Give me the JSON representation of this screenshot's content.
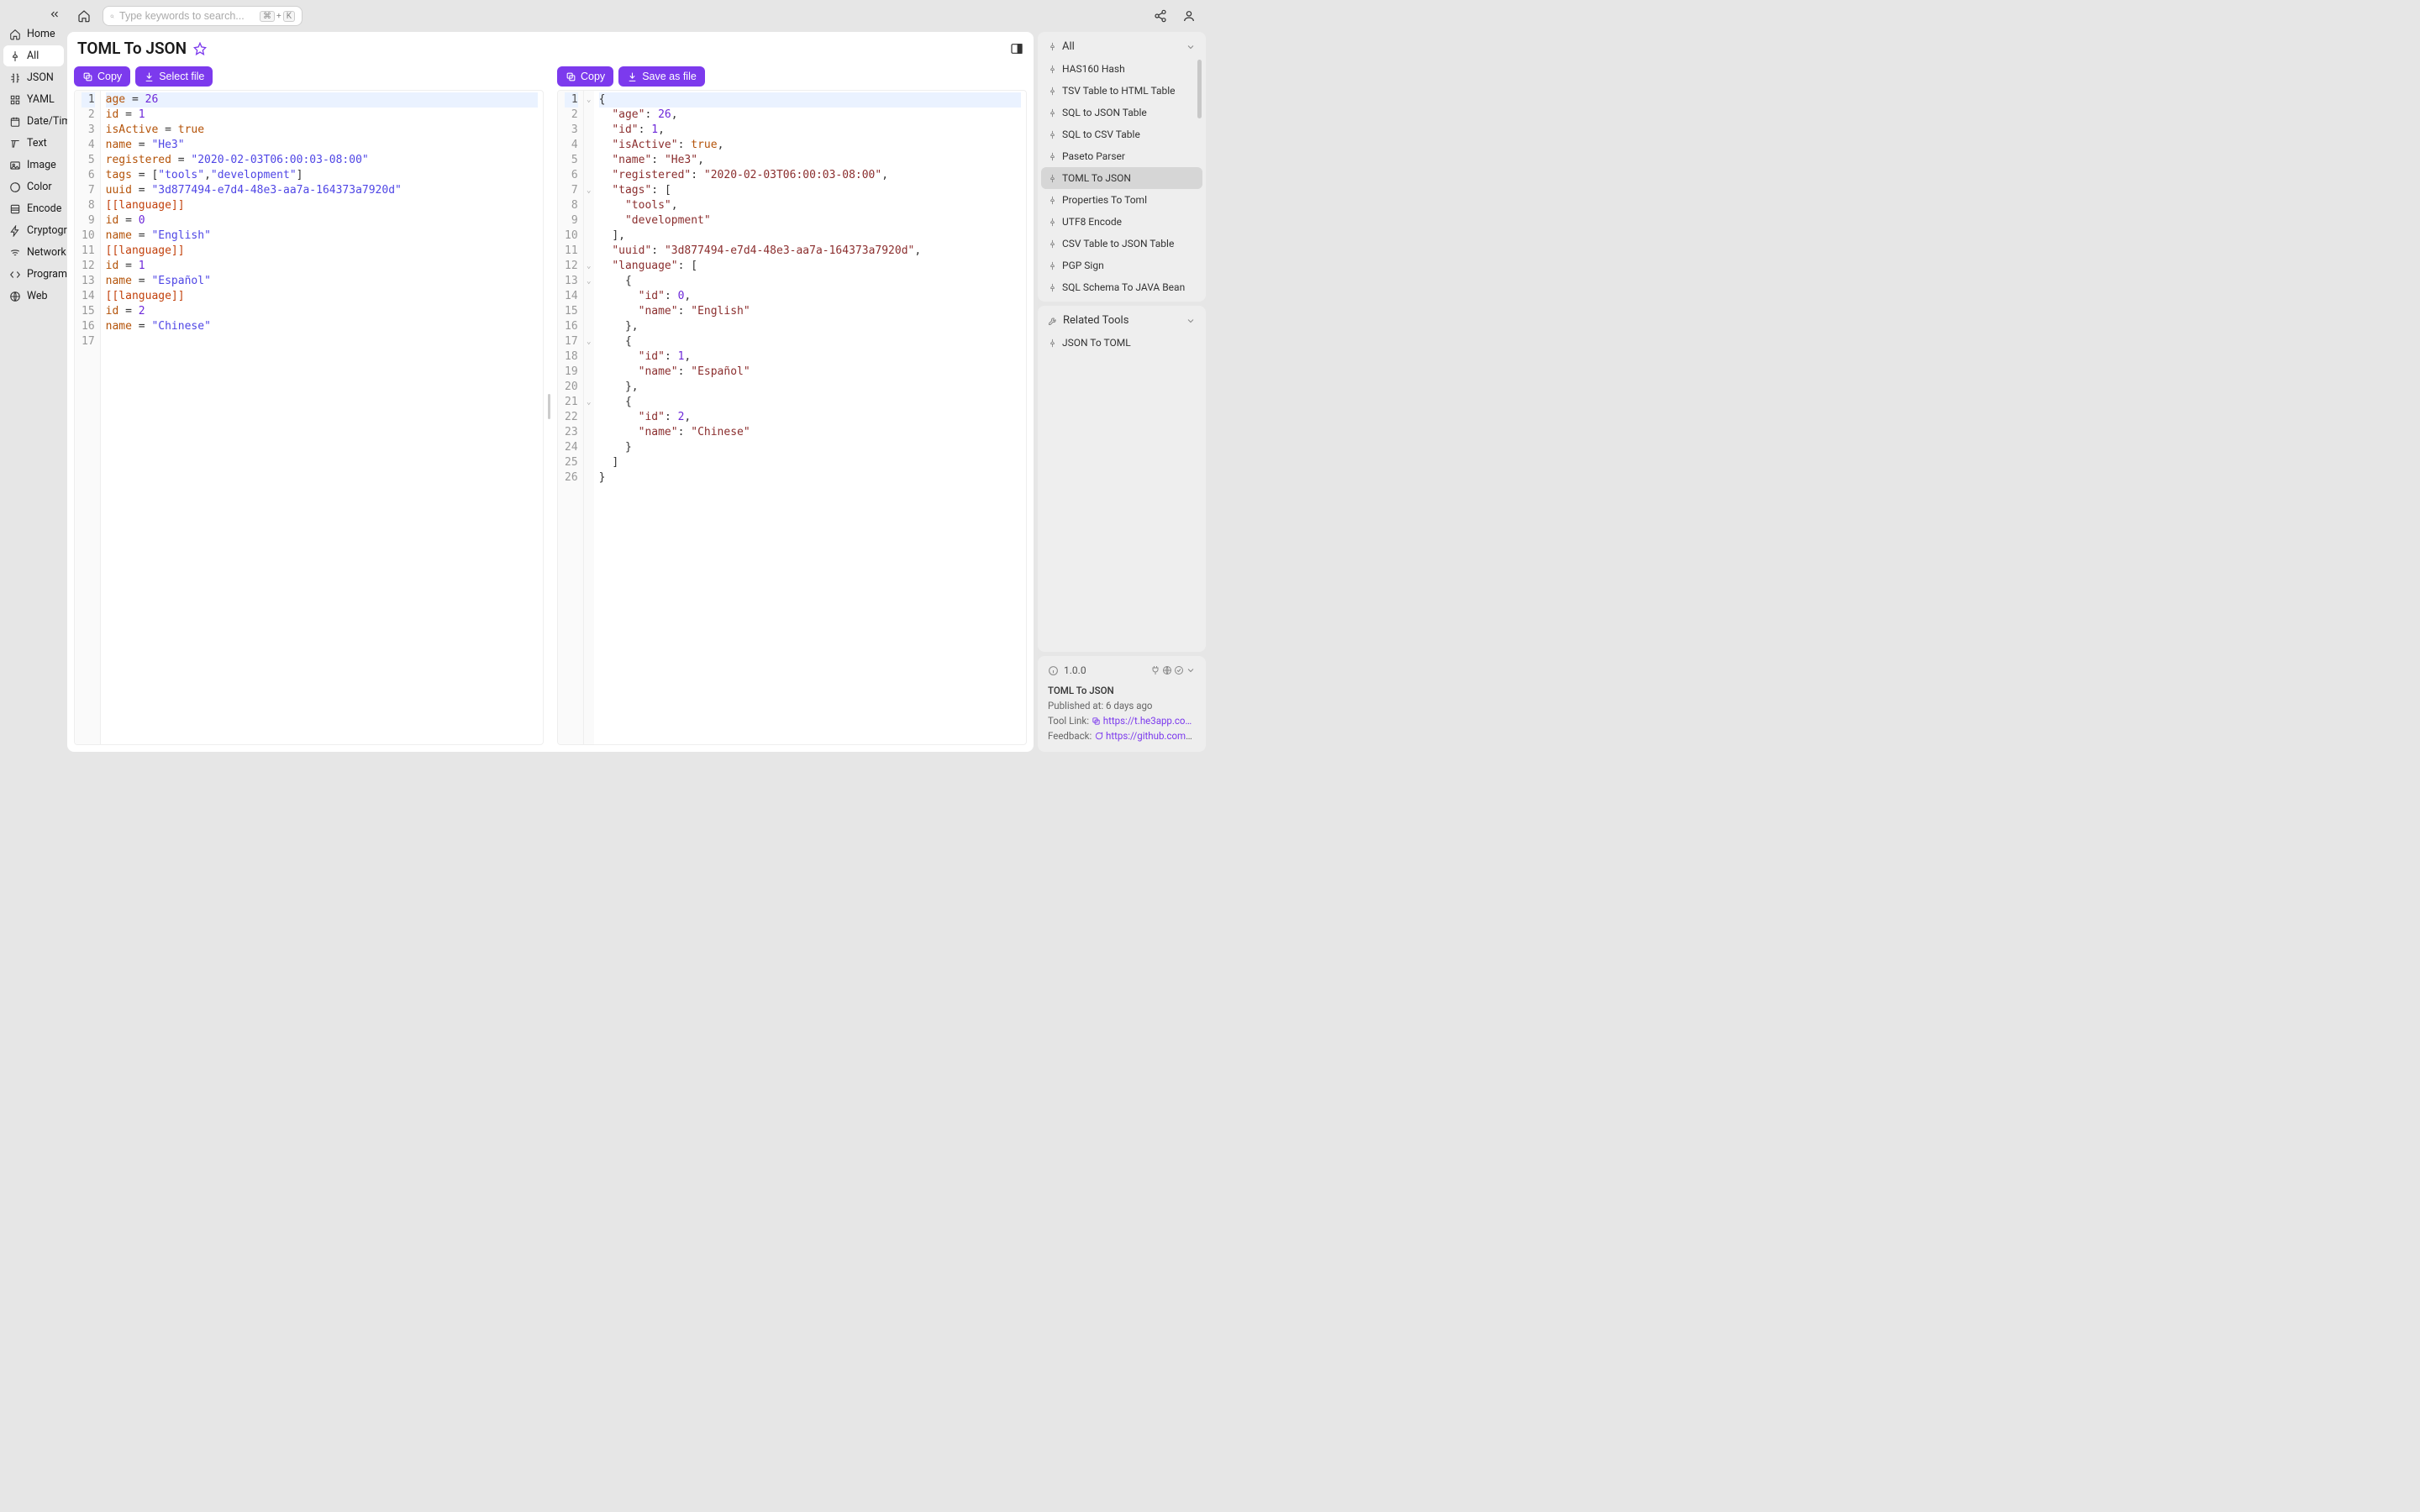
{
  "search": {
    "placeholder": "Type keywords to search...",
    "kbd1": "⌘",
    "plus": "+",
    "kbd2": "K"
  },
  "sidebar": {
    "items": [
      {
        "label": "Home"
      },
      {
        "label": "All"
      },
      {
        "label": "JSON"
      },
      {
        "label": "YAML"
      },
      {
        "label": "Date/Time"
      },
      {
        "label": "Text"
      },
      {
        "label": "Image"
      },
      {
        "label": "Color"
      },
      {
        "label": "Encode"
      },
      {
        "label": "Cryptography"
      },
      {
        "label": "Network"
      },
      {
        "label": "Programming"
      },
      {
        "label": "Web"
      }
    ]
  },
  "page": {
    "title": "TOML To JSON"
  },
  "buttons": {
    "copy": "Copy",
    "select_file": "Select file",
    "save_as_file": "Save as file"
  },
  "editor_left": {
    "lines": [
      [
        {
          "t": "age ",
          "c": "tok-key"
        },
        {
          "t": "= ",
          "c": "tok-op"
        },
        {
          "t": "26",
          "c": "tok-num"
        }
      ],
      [
        {
          "t": "id ",
          "c": "tok-key"
        },
        {
          "t": "= ",
          "c": "tok-op"
        },
        {
          "t": "1",
          "c": "tok-num"
        }
      ],
      [
        {
          "t": "isActive ",
          "c": "tok-key"
        },
        {
          "t": "= ",
          "c": "tok-op"
        },
        {
          "t": "true",
          "c": "tok-bool"
        }
      ],
      [
        {
          "t": "name ",
          "c": "tok-key"
        },
        {
          "t": "= ",
          "c": "tok-op"
        },
        {
          "t": "\"He3\"",
          "c": "tok-str"
        }
      ],
      [
        {
          "t": "registered ",
          "c": "tok-key"
        },
        {
          "t": "= ",
          "c": "tok-op"
        },
        {
          "t": "\"2020-02-03T06:00:03-08:00\"",
          "c": "tok-str"
        }
      ],
      [
        {
          "t": "tags ",
          "c": "tok-key"
        },
        {
          "t": "= ",
          "c": "tok-op"
        },
        {
          "t": "[",
          "c": "tok-punct"
        },
        {
          "t": "\"tools\"",
          "c": "tok-str"
        },
        {
          "t": ",",
          "c": "tok-punct"
        },
        {
          "t": "\"development\"",
          "c": "tok-str"
        },
        {
          "t": "]",
          "c": "tok-punct"
        }
      ],
      [
        {
          "t": "uuid ",
          "c": "tok-key"
        },
        {
          "t": "= ",
          "c": "tok-op"
        },
        {
          "t": "\"3d877494-e7d4-48e3-aa7a-164373a7920d\"",
          "c": "tok-str"
        }
      ],
      [
        {
          "t": "[[language]]",
          "c": "tok-sect"
        }
      ],
      [
        {
          "t": "id ",
          "c": "tok-key"
        },
        {
          "t": "= ",
          "c": "tok-op"
        },
        {
          "t": "0",
          "c": "tok-num"
        }
      ],
      [
        {
          "t": "name ",
          "c": "tok-key"
        },
        {
          "t": "= ",
          "c": "tok-op"
        },
        {
          "t": "\"English\"",
          "c": "tok-str"
        }
      ],
      [
        {
          "t": "[[language]]",
          "c": "tok-sect"
        }
      ],
      [
        {
          "t": "id ",
          "c": "tok-key"
        },
        {
          "t": "= ",
          "c": "tok-op"
        },
        {
          "t": "1",
          "c": "tok-num"
        }
      ],
      [
        {
          "t": "name ",
          "c": "tok-key"
        },
        {
          "t": "= ",
          "c": "tok-op"
        },
        {
          "t": "\"Español\"",
          "c": "tok-str"
        }
      ],
      [
        {
          "t": "[[language]]",
          "c": "tok-sect"
        }
      ],
      [
        {
          "t": "id ",
          "c": "tok-key"
        },
        {
          "t": "= ",
          "c": "tok-op"
        },
        {
          "t": "2",
          "c": "tok-num"
        }
      ],
      [
        {
          "t": "name ",
          "c": "tok-key"
        },
        {
          "t": "= ",
          "c": "tok-op"
        },
        {
          "t": "\"Chinese\"",
          "c": "tok-str"
        }
      ],
      [
        {
          "t": "",
          "c": ""
        }
      ]
    ],
    "line_count": 17
  },
  "editor_right": {
    "lines": [
      [
        {
          "t": "{",
          "c": "tok-punct"
        }
      ],
      [
        {
          "t": "  ",
          "c": ""
        },
        {
          "t": "\"age\"",
          "c": "tok-jkey"
        },
        {
          "t": ": ",
          "c": "tok-punct"
        },
        {
          "t": "26",
          "c": "tok-num"
        },
        {
          "t": ",",
          "c": "tok-punct"
        }
      ],
      [
        {
          "t": "  ",
          "c": ""
        },
        {
          "t": "\"id\"",
          "c": "tok-jkey"
        },
        {
          "t": ": ",
          "c": "tok-punct"
        },
        {
          "t": "1",
          "c": "tok-num"
        },
        {
          "t": ",",
          "c": "tok-punct"
        }
      ],
      [
        {
          "t": "  ",
          "c": ""
        },
        {
          "t": "\"isActive\"",
          "c": "tok-jkey"
        },
        {
          "t": ": ",
          "c": "tok-punct"
        },
        {
          "t": "true",
          "c": "tok-bool"
        },
        {
          "t": ",",
          "c": "tok-punct"
        }
      ],
      [
        {
          "t": "  ",
          "c": ""
        },
        {
          "t": "\"name\"",
          "c": "tok-jkey"
        },
        {
          "t": ": ",
          "c": "tok-punct"
        },
        {
          "t": "\"He3\"",
          "c": "tok-str2"
        },
        {
          "t": ",",
          "c": "tok-punct"
        }
      ],
      [
        {
          "t": "  ",
          "c": ""
        },
        {
          "t": "\"registered\"",
          "c": "tok-jkey"
        },
        {
          "t": ": ",
          "c": "tok-punct"
        },
        {
          "t": "\"2020-02-03T06:00:03-08:00\"",
          "c": "tok-str2"
        },
        {
          "t": ",",
          "c": "tok-punct"
        }
      ],
      [
        {
          "t": "  ",
          "c": ""
        },
        {
          "t": "\"tags\"",
          "c": "tok-jkey"
        },
        {
          "t": ": ",
          "c": "tok-punct"
        },
        {
          "t": "[",
          "c": "tok-punct"
        }
      ],
      [
        {
          "t": "    ",
          "c": ""
        },
        {
          "t": "\"tools\"",
          "c": "tok-str2"
        },
        {
          "t": ",",
          "c": "tok-punct"
        }
      ],
      [
        {
          "t": "    ",
          "c": ""
        },
        {
          "t": "\"development\"",
          "c": "tok-str2"
        }
      ],
      [
        {
          "t": "  ",
          "c": ""
        },
        {
          "t": "]",
          "c": "tok-punct"
        },
        {
          "t": ",",
          "c": "tok-punct"
        }
      ],
      [
        {
          "t": "  ",
          "c": ""
        },
        {
          "t": "\"uuid\"",
          "c": "tok-jkey"
        },
        {
          "t": ": ",
          "c": "tok-punct"
        },
        {
          "t": "\"3d877494-e7d4-48e3-aa7a-164373a7920d\"",
          "c": "tok-str2"
        },
        {
          "t": ",",
          "c": "tok-punct"
        }
      ],
      [
        {
          "t": "  ",
          "c": ""
        },
        {
          "t": "\"language\"",
          "c": "tok-jkey"
        },
        {
          "t": ": ",
          "c": "tok-punct"
        },
        {
          "t": "[",
          "c": "tok-punct"
        }
      ],
      [
        {
          "t": "    ",
          "c": ""
        },
        {
          "t": "{",
          "c": "tok-punct"
        }
      ],
      [
        {
          "t": "      ",
          "c": ""
        },
        {
          "t": "\"id\"",
          "c": "tok-jkey"
        },
        {
          "t": ": ",
          "c": "tok-punct"
        },
        {
          "t": "0",
          "c": "tok-num"
        },
        {
          "t": ",",
          "c": "tok-punct"
        }
      ],
      [
        {
          "t": "      ",
          "c": ""
        },
        {
          "t": "\"name\"",
          "c": "tok-jkey"
        },
        {
          "t": ": ",
          "c": "tok-punct"
        },
        {
          "t": "\"English\"",
          "c": "tok-str2"
        }
      ],
      [
        {
          "t": "    ",
          "c": ""
        },
        {
          "t": "}",
          "c": "tok-punct"
        },
        {
          "t": ",",
          "c": "tok-punct"
        }
      ],
      [
        {
          "t": "    ",
          "c": ""
        },
        {
          "t": "{",
          "c": "tok-punct"
        }
      ],
      [
        {
          "t": "      ",
          "c": ""
        },
        {
          "t": "\"id\"",
          "c": "tok-jkey"
        },
        {
          "t": ": ",
          "c": "tok-punct"
        },
        {
          "t": "1",
          "c": "tok-num"
        },
        {
          "t": ",",
          "c": "tok-punct"
        }
      ],
      [
        {
          "t": "      ",
          "c": ""
        },
        {
          "t": "\"name\"",
          "c": "tok-jkey"
        },
        {
          "t": ": ",
          "c": "tok-punct"
        },
        {
          "t": "\"Español\"",
          "c": "tok-str2"
        }
      ],
      [
        {
          "t": "    ",
          "c": ""
        },
        {
          "t": "}",
          "c": "tok-punct"
        },
        {
          "t": ",",
          "c": "tok-punct"
        }
      ],
      [
        {
          "t": "    ",
          "c": ""
        },
        {
          "t": "{",
          "c": "tok-punct"
        }
      ],
      [
        {
          "t": "      ",
          "c": ""
        },
        {
          "t": "\"id\"",
          "c": "tok-jkey"
        },
        {
          "t": ": ",
          "c": "tok-punct"
        },
        {
          "t": "2",
          "c": "tok-num"
        },
        {
          "t": ",",
          "c": "tok-punct"
        }
      ],
      [
        {
          "t": "      ",
          "c": ""
        },
        {
          "t": "\"name\"",
          "c": "tok-jkey"
        },
        {
          "t": ": ",
          "c": "tok-punct"
        },
        {
          "t": "\"Chinese\"",
          "c": "tok-str2"
        }
      ],
      [
        {
          "t": "    ",
          "c": ""
        },
        {
          "t": "}",
          "c": "tok-punct"
        }
      ],
      [
        {
          "t": "  ",
          "c": ""
        },
        {
          "t": "]",
          "c": "tok-punct"
        }
      ],
      [
        {
          "t": "}",
          "c": "tok-punct"
        }
      ]
    ],
    "fold_rows": [
      1,
      7,
      12,
      13,
      17,
      21
    ],
    "line_count": 26
  },
  "rail": {
    "all_label": "All",
    "tools": [
      "HAS160 Hash",
      "TSV Table to HTML Table",
      "SQL to JSON Table",
      "SQL to CSV Table",
      "Paseto Parser",
      "TOML To JSON",
      "Properties To Toml",
      "UTF8 Encode",
      "CSV Table to JSON Table",
      "PGP Sign",
      "SQL Schema To JAVA Bean"
    ],
    "active_tool_index": 5,
    "related_label": "Related Tools",
    "related": [
      "JSON To TOML"
    ]
  },
  "meta": {
    "version": "1.0.0",
    "title": "TOML To JSON",
    "published_label": "Published at:",
    "published_value": "6 days ago",
    "tool_link_label": "Tool Link:",
    "tool_link_value": "https://t.he3app.co…",
    "feedback_label": "Feedback:",
    "feedback_value": "https://github.com/…"
  }
}
